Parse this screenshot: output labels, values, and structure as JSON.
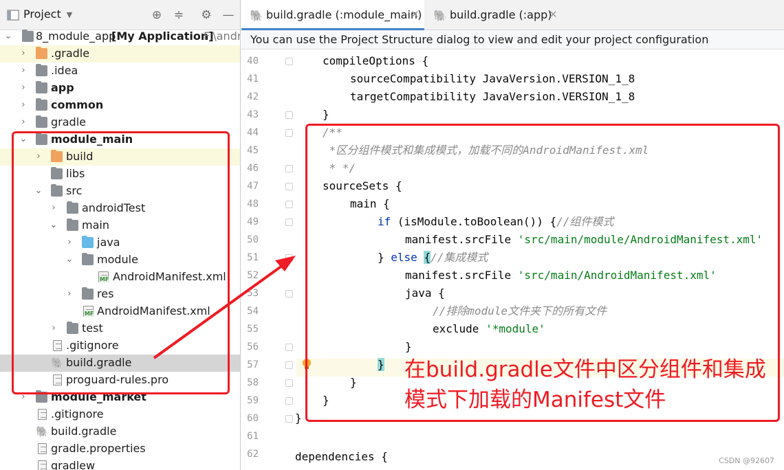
{
  "project_panel": {
    "title": "Project",
    "tree": [
      {
        "label": "8_module_app",
        "extra": "[My Application]",
        "path": "F:\\andro"
      },
      {
        "label": ".gradle"
      },
      {
        "label": ".idea"
      },
      {
        "label": "app"
      },
      {
        "label": "common"
      },
      {
        "label": "gradle"
      },
      {
        "label": "module_main"
      },
      {
        "label": "build"
      },
      {
        "label": "libs"
      },
      {
        "label": "src"
      },
      {
        "label": "androidTest"
      },
      {
        "label": "main"
      },
      {
        "label": "java"
      },
      {
        "label": "module"
      },
      {
        "label": "AndroidManifest.xml"
      },
      {
        "label": "res"
      },
      {
        "label": "AndroidManifest.xml"
      },
      {
        "label": "test"
      },
      {
        "label": ".gitignore"
      },
      {
        "label": "build.gradle"
      },
      {
        "label": "proguard-rules.pro"
      },
      {
        "label": "module_market"
      },
      {
        "label": ".gitignore"
      },
      {
        "label": "build.gradle"
      },
      {
        "label": "gradle.properties"
      },
      {
        "label": "gradlew"
      }
    ]
  },
  "editor": {
    "tabs": [
      {
        "label": "build.gradle (:module_main)"
      },
      {
        "label": "build.gradle (:app)"
      }
    ],
    "notice": "You can use the Project Structure dialog to view and edit your project configuration",
    "line_numbers": [
      "40",
      "41",
      "42",
      "43",
      "44",
      "45",
      "46",
      "47",
      "48",
      "49",
      "50",
      "51",
      "52",
      "53",
      "54",
      "55",
      "56",
      "57",
      "58",
      "59",
      "60",
      "61",
      "62"
    ],
    "code": {
      "l40": "compileOptions {",
      "l41_a": "sourceCompatibility ",
      "l41_b": "JavaVersion.VERSION_1_8",
      "l42_a": "targetCompatibility ",
      "l42_b": "JavaVersion.VERSION_1_8",
      "l43": "}",
      "l44": "/**",
      "l45": " *区分组件模式和集成模式，加载不同的AndroidManifest.xml",
      "l46": " * */",
      "l47": "sourceSets {",
      "l48": "main {",
      "l49_kw": "if",
      "l49_a": " (isModule.toBoolean()) {",
      "l49_c": "//组件模式",
      "l50_a": "manifest.srcFile ",
      "l50_s": "'src/main/module/AndroidManifest.xml'",
      "l51_a": "} ",
      "l51_kw": "else",
      "l51_b": " ",
      "l51_brace": "{",
      "l51_c": "//集成模式",
      "l52_a": "manifest.srcFile ",
      "l52_s": "'src/main/AndroidManifest.xml'",
      "l53": "java {",
      "l54": "//排除module文件夹下的所有文件",
      "l55_a": "exclude ",
      "l55_s": "'*module'",
      "l56": "}",
      "l57": "}",
      "l58": "}",
      "l59": "}",
      "l60": "}",
      "l62": "dependencies {"
    }
  },
  "annotation": {
    "text": "在build.gradle文件中区分组件和集成模式下加载的Manifest文件",
    "color": "#ee1c24"
  },
  "watermark": "CSDN @92607"
}
